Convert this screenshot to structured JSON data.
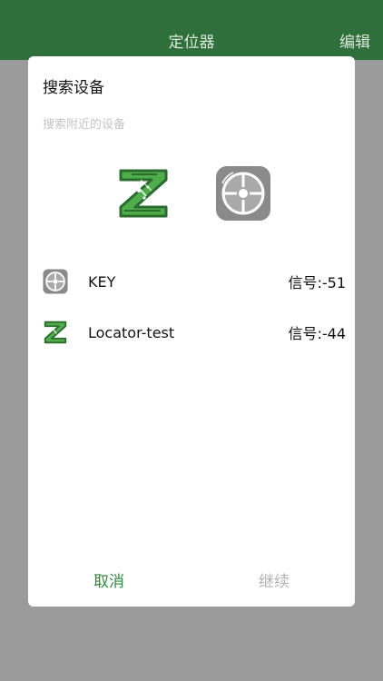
{
  "nav": {
    "title": "定位器",
    "edit_label": "编辑"
  },
  "dialog": {
    "title": "搜索设备",
    "subtitle": "搜索附近的设备",
    "devices": [
      {
        "name": "KEY",
        "signal": "信号:-51",
        "icon": "key-device-icon"
      },
      {
        "name": "Locator-test",
        "signal": "信号:-44",
        "icon": "locator-z-icon"
      }
    ],
    "cancel_label": "取消",
    "continue_label": "继续"
  },
  "colors": {
    "nav_bg": "#2f6f3b",
    "accent": "#2f8a3f",
    "disabled": "#b3b3b3",
    "overlay": "#9b9b9b",
    "logo_green": "#4fae4a",
    "logo_dark": "#2b6b2f",
    "key_gray": "#8a8a8a"
  }
}
